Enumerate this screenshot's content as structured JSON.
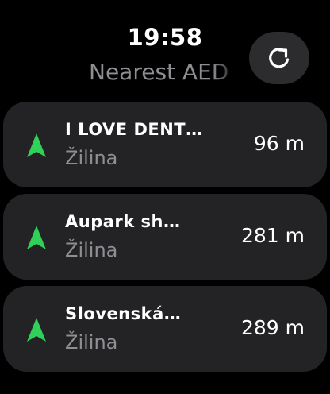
{
  "status_bar": {
    "time": "19:58"
  },
  "header": {
    "title": "Nearest AED",
    "refresh_icon": "refresh-icon"
  },
  "accent_color": "#30d158",
  "items": [
    {
      "name": "I LOVE DENT…",
      "city": "Žilina",
      "distance": "96 m",
      "icon": "navigation-arrow-icon"
    },
    {
      "name": "Aupark sh…",
      "city": "Žilina",
      "distance": "281 m",
      "icon": "navigation-arrow-icon"
    },
    {
      "name": "Slovenská…",
      "city": "Žilina",
      "distance": "289 m",
      "icon": "navigation-arrow-icon"
    }
  ]
}
